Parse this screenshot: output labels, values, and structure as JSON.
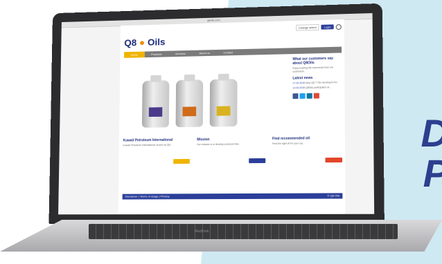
{
  "side_text": [
    "D",
    "P"
  ],
  "browser": {
    "url": "q8oils.com"
  },
  "brand": {
    "q8": "Q8",
    "oils": "Oils"
  },
  "header": {
    "login": "Login",
    "language": "Change select"
  },
  "nav": [
    "Home",
    "Products",
    "Services",
    "About us",
    "Contact"
  ],
  "right_panel": {
    "title": "What our customers say about Q8Oils",
    "body": "Enjoy reading the comments from our customers...",
    "news_title": "Latest news",
    "news": [
      {
        "date": "17.04.2016",
        "text": "New Q8 T 750 developed for..."
      },
      {
        "date": "12.03.2016",
        "text": "Q8Oils participates at..."
      }
    ]
  },
  "columns": [
    {
      "title": "Kuwait Petroleum International",
      "text": "Kuwait Petroleum International, known as Q8...",
      "button_color": "#f0b400"
    },
    {
      "title": "Mission",
      "text": "Our mission is to develop products that...",
      "button_color": "#2b3f9a"
    },
    {
      "title": "Find recommended oil",
      "text": "Find the right oil for your car...",
      "button_color": "#e2452a"
    }
  ],
  "footer": {
    "text": "Disclaimer | Terms of usage | Privacy",
    "right": "© Q8 Oils"
  },
  "laptop_label": "MacBook",
  "colors": {
    "brand_blue": "#2b3f9a",
    "accent_orange": "#f08a00",
    "nav_grey": "#7b7b7b",
    "facebook": "#3b5998",
    "twitter": "#1da1f2",
    "linkedin": "#0e76a8",
    "google": "#dd4b39"
  }
}
